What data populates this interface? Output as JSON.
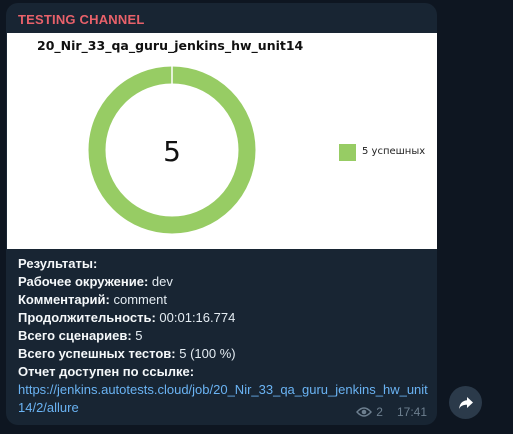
{
  "channel": {
    "name": "TESTING CHANNEL"
  },
  "chart_data": {
    "type": "pie",
    "title": "20_Nir_33_qa_guru_jenkins_hw_unit14",
    "center_label": "5",
    "slices": [
      {
        "label": "5 успешных",
        "value": 5,
        "color": "#97cc64"
      }
    ],
    "legend": "right"
  },
  "report": {
    "results_label": "Результаты:",
    "env_label": "Рабочее окружение:",
    "env_value": "dev",
    "comment_label": "Комментарий:",
    "comment_value": "comment",
    "duration_label": "Продолжительность:",
    "duration_value": "00:01:16.774",
    "scenarios_label": "Всего сценариев:",
    "scenarios_value": "5",
    "passed_label": "Всего успешных тестов:",
    "passed_value": "5 (100 %)",
    "link_label": "Отчет доступен по ссылке:",
    "link_url": "https://jenkins.autotests.cloud/job/20_Nir_33_qa_guru_jenkins_hw_unit14/2/allure"
  },
  "meta": {
    "views": "2",
    "time": "17:41",
    "view_icon": "eye-icon",
    "share_icon": "share-arrow-icon"
  }
}
